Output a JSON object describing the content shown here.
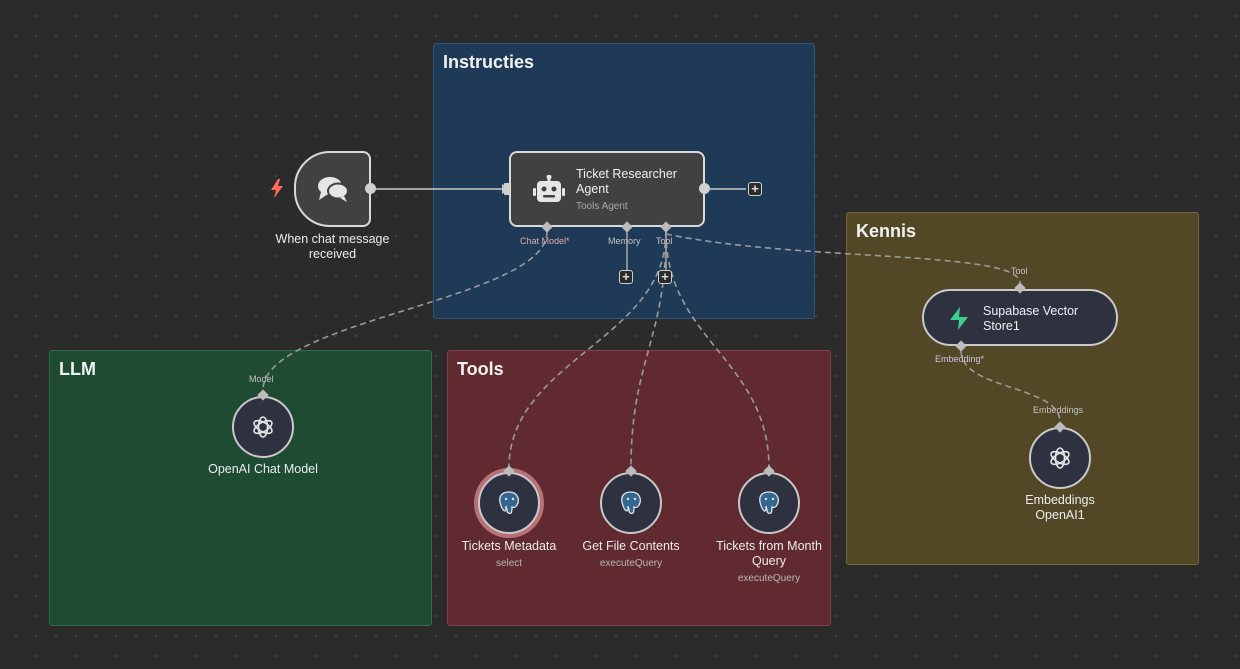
{
  "groups": {
    "instructies": "Instructies",
    "llm": "LLM",
    "tools": "Tools",
    "kennis": "Kennis"
  },
  "nodes": {
    "trigger": {
      "label": "When chat message received",
      "icon": "chat-bubbles-icon",
      "trigger_icon": "lightning-icon"
    },
    "agent": {
      "title": "Ticket Researcher Agent",
      "subtitle": "Tools Agent",
      "icon": "robot-icon"
    },
    "chat_model": {
      "label": "OpenAI Chat Model",
      "icon": "openai-icon"
    },
    "tickets_metadata": {
      "label": "Tickets Metadata",
      "sub": "select",
      "icon": "postgres-icon"
    },
    "get_file_contents": {
      "label": "Get File Contents",
      "sub": "executeQuery",
      "icon": "postgres-icon"
    },
    "tickets_month": {
      "label": "Tickets from Month Query",
      "sub": "executeQuery",
      "icon": "postgres-icon"
    },
    "vector_store": {
      "label": "Supabase Vector Store1",
      "icon": "supabase-icon"
    },
    "embeddings": {
      "label": "Embeddings OpenAI1",
      "icon": "openai-icon"
    }
  },
  "ports": {
    "chat_model": "Chat Model*",
    "memory": "Memory",
    "tool": "Tool",
    "model": "Model",
    "vector_tool": "Tool",
    "embedding": "Embedding*",
    "embeddings": "Embeddings"
  },
  "colors": {
    "canvas": "#2b2b2b",
    "instructies_bg": "#1f3a56",
    "llm_bg": "#1f4b33",
    "tools_bg": "#612a30",
    "kennis_bg": "#534826",
    "trigger_icon": "#ff6d5a",
    "supabase": "#3ecf8e",
    "postgres": "#336791"
  }
}
